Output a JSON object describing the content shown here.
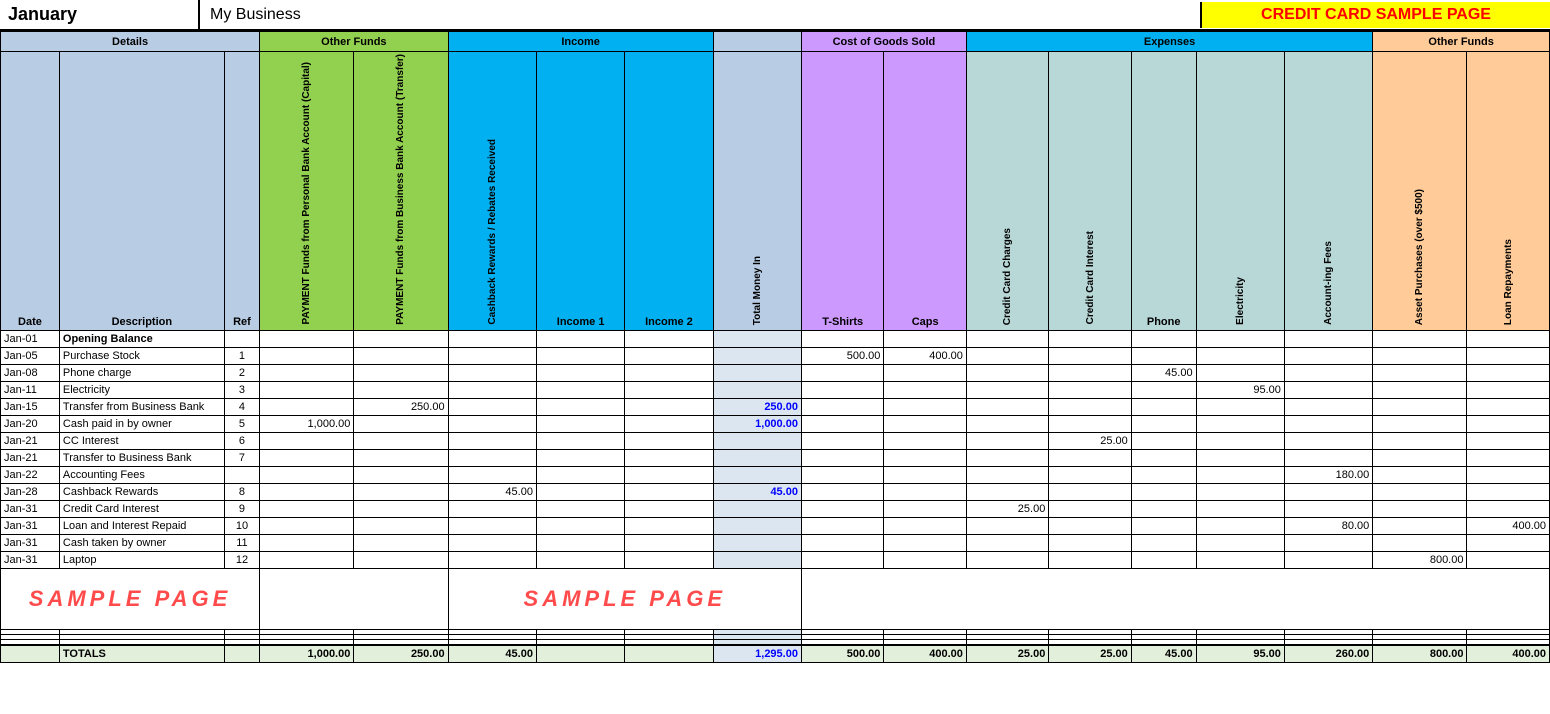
{
  "topBar": {
    "month": "January",
    "business": "My Business",
    "creditTitle": "CREDIT CARD SAMPLE PAGE"
  },
  "sectionHeaders": {
    "details": "Details",
    "otherFunds": "Other Funds",
    "income": "Income",
    "cogs": "Cost of Goods Sold",
    "expenses": "Expenses",
    "otherFunds2": "Other Funds"
  },
  "columnHeaders": {
    "date": "Date",
    "description": "Description",
    "ref": "Ref",
    "paymentPersonal": "PAYMENT Funds from Personal Bank Account (Capital)",
    "paymentBusiness": "PAYMENT Funds from Business Bank Account (Transfer)",
    "cashback": "Cashback Rewards / Rebates Received",
    "income1": "Income 1",
    "income2": "Income 2",
    "totalMoney": "Total Money In",
    "tshirts": "T-Shirts",
    "caps": "Caps",
    "ccCharges": "Credit Card Charges",
    "ccInterest": "Credit Card Interest",
    "phone": "Phone",
    "electricity": "Electricity",
    "accounting": "Account-ing Fees",
    "asset": "Asset Purchases (over $500)",
    "loan": "Loan Repayments"
  },
  "rows": [
    {
      "date": "Jan-01",
      "desc": "Opening Balance",
      "ref": "",
      "payPersonal": "",
      "payBusiness": "",
      "cashback": "",
      "inc1": "",
      "inc2": "",
      "totalMoney": "",
      "tshirts": "",
      "caps": "",
      "ccCharges": "",
      "ccInterest": "",
      "phone": "",
      "electricity": "",
      "accounting": "",
      "asset": "",
      "loan": "",
      "bold": true
    },
    {
      "date": "Jan-05",
      "desc": "Purchase Stock",
      "ref": "1",
      "payPersonal": "",
      "payBusiness": "",
      "cashback": "",
      "inc1": "",
      "inc2": "",
      "totalMoney": "",
      "tshirts": "500.00",
      "caps": "400.00",
      "ccCharges": "",
      "ccInterest": "",
      "phone": "",
      "electricity": "",
      "accounting": "",
      "asset": "",
      "loan": ""
    },
    {
      "date": "Jan-08",
      "desc": "Phone charge",
      "ref": "2",
      "payPersonal": "",
      "payBusiness": "",
      "cashback": "",
      "inc1": "",
      "inc2": "",
      "totalMoney": "",
      "tshirts": "",
      "caps": "",
      "ccCharges": "",
      "ccInterest": "",
      "phone": "45.00",
      "electricity": "",
      "accounting": "",
      "asset": "",
      "loan": ""
    },
    {
      "date": "Jan-11",
      "desc": "Electricity",
      "ref": "3",
      "payPersonal": "",
      "payBusiness": "",
      "cashback": "",
      "inc1": "",
      "inc2": "",
      "totalMoney": "",
      "tshirts": "",
      "caps": "",
      "ccCharges": "",
      "ccInterest": "",
      "phone": "",
      "electricity": "95.00",
      "accounting": "",
      "asset": "",
      "loan": ""
    },
    {
      "date": "Jan-15",
      "desc": "Transfer from Business Bank",
      "ref": "4",
      "payPersonal": "",
      "payBusiness": "250.00",
      "cashback": "",
      "inc1": "",
      "inc2": "",
      "totalMoney": "250.00",
      "tshirts": "",
      "caps": "",
      "ccCharges": "",
      "ccInterest": "",
      "phone": "",
      "electricity": "",
      "accounting": "",
      "asset": "",
      "loan": ""
    },
    {
      "date": "Jan-20",
      "desc": "Cash paid in by owner",
      "ref": "5",
      "payPersonal": "1,000.00",
      "payBusiness": "",
      "cashback": "",
      "inc1": "",
      "inc2": "",
      "totalMoney": "1,000.00",
      "tshirts": "",
      "caps": "",
      "ccCharges": "",
      "ccInterest": "",
      "phone": "",
      "electricity": "",
      "accounting": "",
      "asset": "",
      "loan": ""
    },
    {
      "date": "Jan-21",
      "desc": "CC Interest",
      "ref": "6",
      "payPersonal": "",
      "payBusiness": "",
      "cashback": "",
      "inc1": "",
      "inc2": "",
      "totalMoney": "",
      "tshirts": "",
      "caps": "",
      "ccCharges": "",
      "ccInterest": "25.00",
      "phone": "",
      "electricity": "",
      "accounting": "",
      "asset": "",
      "loan": ""
    },
    {
      "date": "Jan-21",
      "desc": "Transfer to Business Bank",
      "ref": "7",
      "payPersonal": "",
      "payBusiness": "",
      "cashback": "",
      "inc1": "",
      "inc2": "",
      "totalMoney": "",
      "tshirts": "",
      "caps": "",
      "ccCharges": "",
      "ccInterest": "",
      "phone": "",
      "electricity": "",
      "accounting": "",
      "asset": "",
      "loan": ""
    },
    {
      "date": "Jan-22",
      "desc": "Accounting Fees",
      "ref": "",
      "payPersonal": "",
      "payBusiness": "",
      "cashback": "",
      "inc1": "",
      "inc2": "",
      "totalMoney": "",
      "tshirts": "",
      "caps": "",
      "ccCharges": "",
      "ccInterest": "",
      "phone": "",
      "electricity": "",
      "accounting": "180.00",
      "asset": "",
      "loan": ""
    },
    {
      "date": "Jan-28",
      "desc": "Cashback Rewards",
      "ref": "8",
      "payPersonal": "",
      "payBusiness": "",
      "cashback": "45.00",
      "inc1": "",
      "inc2": "",
      "totalMoney": "45.00",
      "tshirts": "",
      "caps": "",
      "ccCharges": "",
      "ccInterest": "",
      "phone": "",
      "electricity": "",
      "accounting": "",
      "asset": "",
      "loan": ""
    },
    {
      "date": "Jan-31",
      "desc": "Credit Card Interest",
      "ref": "9",
      "payPersonal": "",
      "payBusiness": "",
      "cashback": "",
      "inc1": "",
      "inc2": "",
      "totalMoney": "",
      "tshirts": "",
      "caps": "",
      "ccCharges": "25.00",
      "ccInterest": "",
      "phone": "",
      "electricity": "",
      "accounting": "",
      "asset": "",
      "loan": ""
    },
    {
      "date": "Jan-31",
      "desc": "Loan and Interest Repaid",
      "ref": "10",
      "payPersonal": "",
      "payBusiness": "",
      "cashback": "",
      "inc1": "",
      "inc2": "",
      "totalMoney": "",
      "tshirts": "",
      "caps": "",
      "ccCharges": "",
      "ccInterest": "",
      "phone": "",
      "electricity": "",
      "accounting": "80.00",
      "asset": "",
      "loan": "400.00"
    },
    {
      "date": "Jan-31",
      "desc": "Cash taken by owner",
      "ref": "11",
      "payPersonal": "",
      "payBusiness": "",
      "cashback": "",
      "inc1": "",
      "inc2": "",
      "totalMoney": "",
      "tshirts": "",
      "caps": "",
      "ccCharges": "",
      "ccInterest": "",
      "phone": "",
      "electricity": "",
      "accounting": "",
      "asset": "",
      "loan": ""
    },
    {
      "date": "Jan-31",
      "desc": "Laptop",
      "ref": "12",
      "payPersonal": "",
      "payBusiness": "",
      "cashback": "",
      "inc1": "",
      "inc2": "",
      "totalMoney": "",
      "tshirts": "",
      "caps": "",
      "ccCharges": "",
      "ccInterest": "",
      "phone": "",
      "electricity": "",
      "accounting": "",
      "asset": "800.00",
      "loan": ""
    },
    {
      "date": "",
      "desc": "",
      "ref": "",
      "payPersonal": "",
      "payBusiness": "",
      "cashback": "",
      "inc1": "",
      "inc2": "",
      "totalMoney": "",
      "tshirts": "",
      "caps": "",
      "ccCharges": "",
      "ccInterest": "",
      "phone": "",
      "electricity": "",
      "accounting": "",
      "asset": "",
      "loan": "",
      "sample": true
    },
    {
      "date": "",
      "desc": "",
      "ref": "",
      "payPersonal": "",
      "payBusiness": "",
      "cashback": "",
      "inc1": "",
      "inc2": "",
      "totalMoney": "",
      "tshirts": "",
      "caps": "",
      "ccCharges": "",
      "ccInterest": "",
      "phone": "",
      "electricity": "",
      "accounting": "",
      "asset": "",
      "loan": ""
    },
    {
      "date": "",
      "desc": "",
      "ref": "",
      "payPersonal": "",
      "payBusiness": "",
      "cashback": "",
      "inc1": "",
      "inc2": "",
      "totalMoney": "",
      "tshirts": "",
      "caps": "",
      "ccCharges": "",
      "ccInterest": "",
      "phone": "",
      "electricity": "",
      "accounting": "",
      "asset": "",
      "loan": ""
    },
    {
      "date": "",
      "desc": "",
      "ref": "",
      "payPersonal": "",
      "payBusiness": "",
      "cashback": "",
      "inc1": "",
      "inc2": "",
      "totalMoney": "",
      "tshirts": "",
      "caps": "",
      "ccCharges": "",
      "ccInterest": "",
      "phone": "",
      "electricity": "",
      "accounting": "",
      "asset": "",
      "loan": ""
    }
  ],
  "totals": {
    "label": "TOTALS",
    "payPersonal": "1,000.00",
    "payBusiness": "250.00",
    "cashback": "45.00",
    "inc1": "",
    "inc2": "",
    "totalMoney": "1,295.00",
    "tshirts": "500.00",
    "caps": "400.00",
    "ccCharges": "25.00",
    "ccInterest": "25.00",
    "phone": "45.00",
    "electricity": "95.00",
    "accounting": "260.00",
    "asset": "800.00",
    "loan": "400.00"
  },
  "sampleText": "SAMPLE PAGE"
}
